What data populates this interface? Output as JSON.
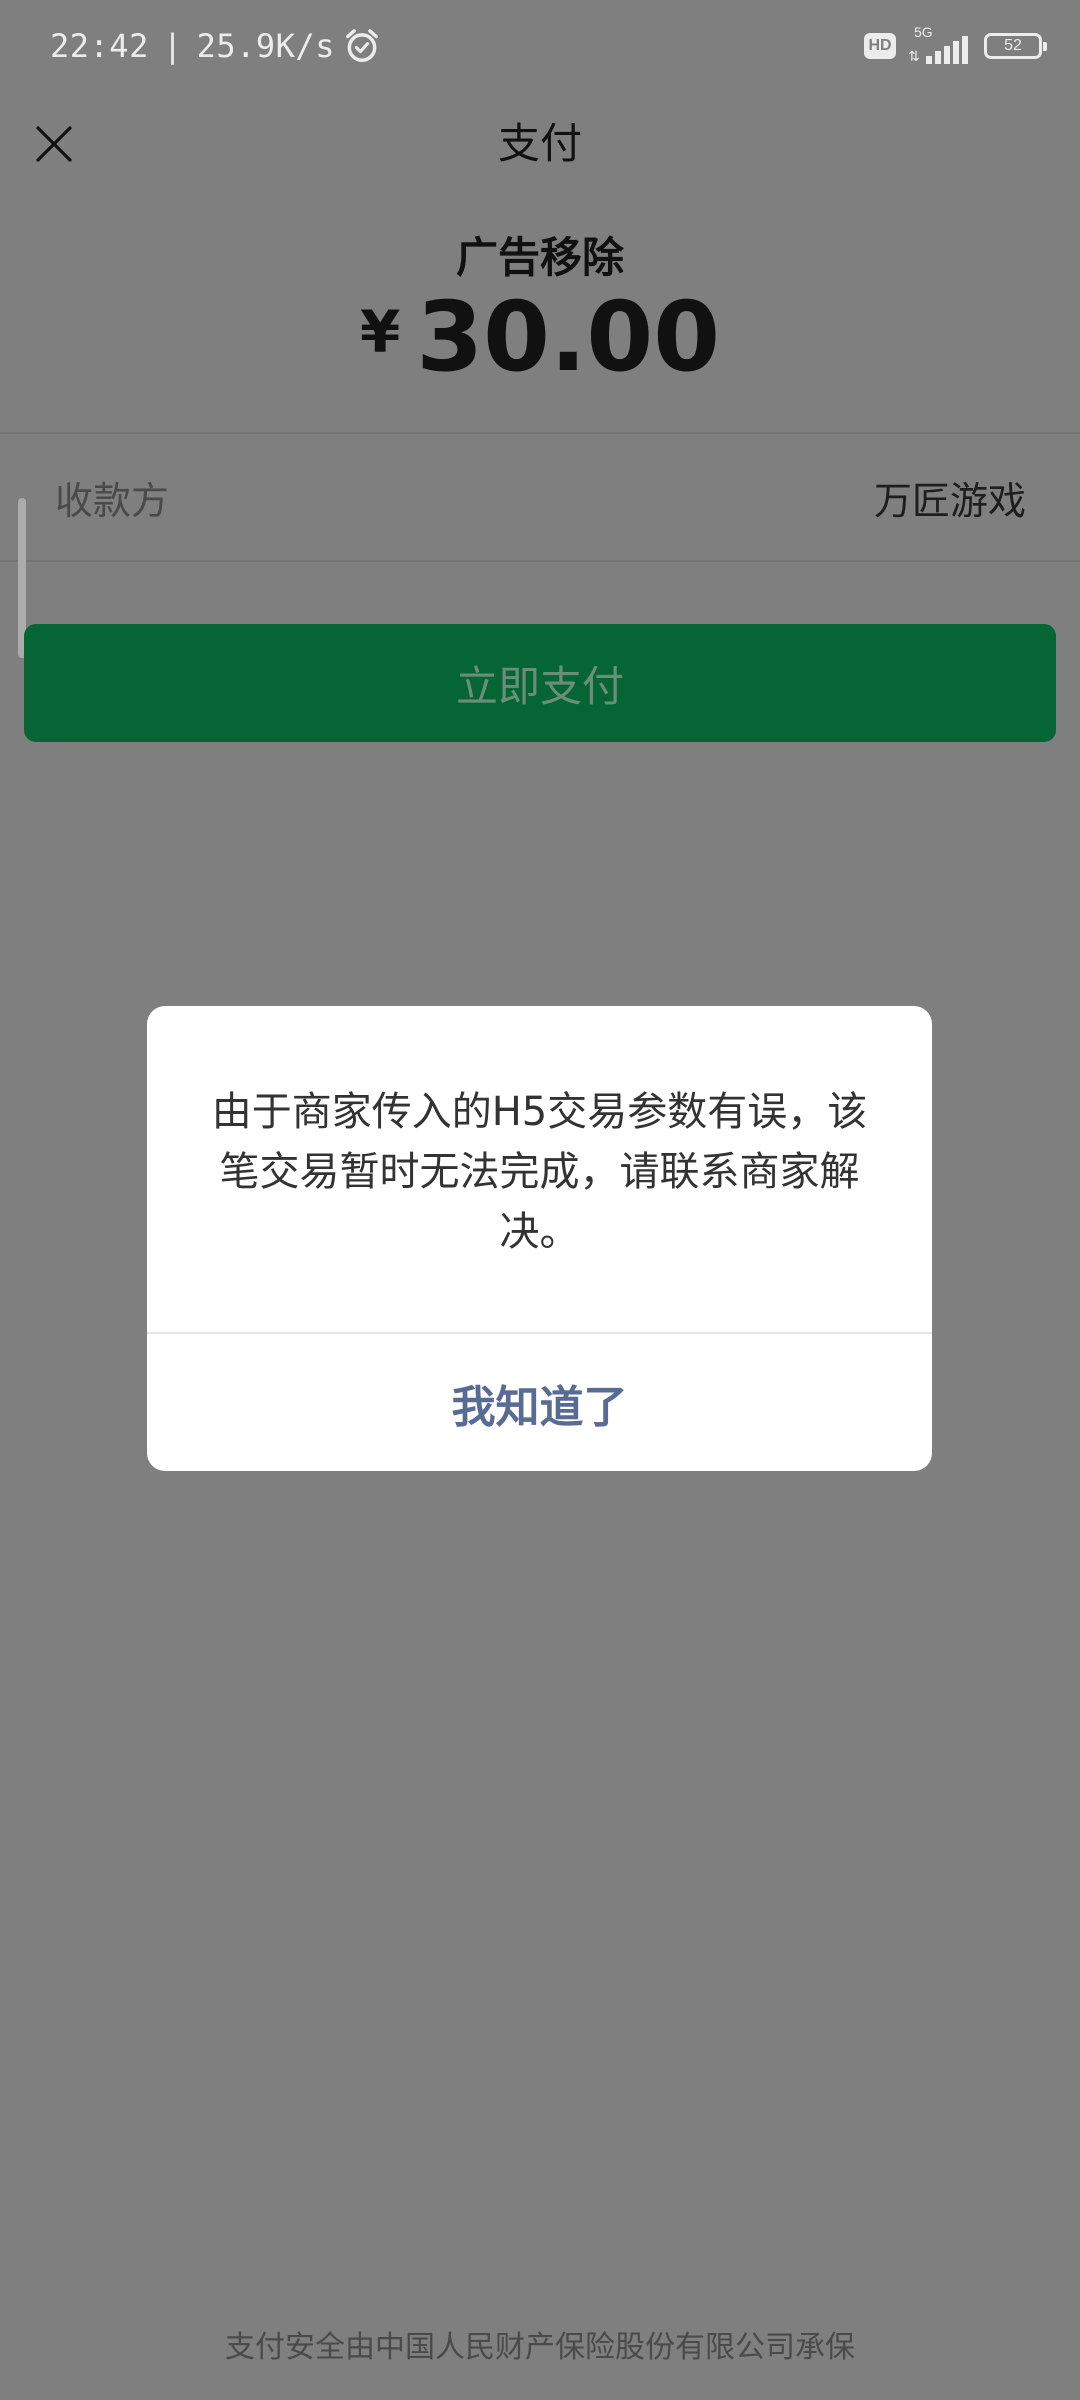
{
  "status_bar": {
    "time": "22:42",
    "separator": "|",
    "net_speed": "25.9K/s",
    "alarm_icon": "alarm-clock-icon",
    "hd_badge": "HD",
    "network_type": "5G",
    "battery_level": "52"
  },
  "nav": {
    "close_icon": "close-icon",
    "title": "支付"
  },
  "payment": {
    "product_name": "广告移除",
    "currency_symbol": "¥",
    "amount": "30.00",
    "payee_label": "收款方",
    "payee_value": "万匠游戏",
    "pay_button_label": "立即支付"
  },
  "dialog": {
    "message": "由于商家传入的H5交易参数有误，该笔交易暂时无法完成，请联系商家解决。",
    "confirm_label": "我知道了"
  },
  "footer": {
    "insurance_note": "支付安全由中国人民财产保险股份有限公司承保"
  },
  "colors": {
    "overlay_background": "#7f7f7f",
    "pay_button": "#056535",
    "dialog_button_text": "#576b95"
  }
}
